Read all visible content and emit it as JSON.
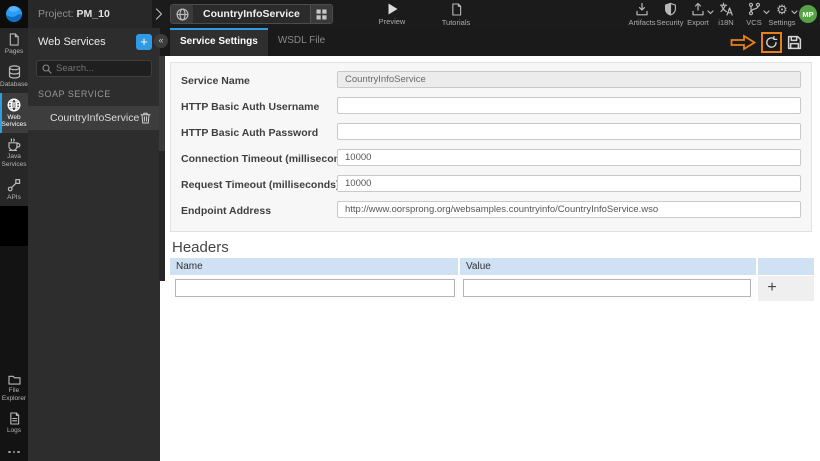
{
  "topbar": {
    "project_prefix": "Project:",
    "project_name": "PM_10",
    "breadcrumb": {
      "service_name": "CountryInfoService"
    },
    "preview_label": "Preview",
    "tutorials_label": "Tutorials",
    "menu": [
      {
        "label": "Artifacts",
        "icon": "download-tray-icon"
      },
      {
        "label": "Security",
        "icon": "shield-icon"
      },
      {
        "label": "Export",
        "icon": "upload-icon",
        "has_chevron": true
      },
      {
        "label": "i18N",
        "icon": "translate-icon"
      },
      {
        "label": "VCS",
        "icon": "branch-icon",
        "has_chevron": true
      },
      {
        "label": "Settings",
        "icon": "gear-icon",
        "has_chevron": true
      }
    ],
    "avatar_initials": "MP"
  },
  "sidebar": {
    "top_items": [
      {
        "label": "Pages",
        "icon": "page-icon",
        "active": false
      },
      {
        "label": "Databases",
        "icon": "database-icon",
        "active": false
      },
      {
        "label": "Web Services",
        "icon": "globe-icon",
        "active": true
      },
      {
        "label": "Java Services",
        "icon": "coffee-icon",
        "active": false
      },
      {
        "label": "APIs",
        "icon": "api-icon",
        "active": false
      }
    ],
    "bottom_items": [
      {
        "label": "File Explorer",
        "icon": "folder-icon"
      },
      {
        "label": "Logs",
        "icon": "log-file-icon"
      }
    ]
  },
  "panel": {
    "title": "Web Services",
    "add_label": "+",
    "collapse_glyph": "«",
    "search_placeholder": "Search...",
    "section_label": "SOAP SERVICE",
    "services": [
      {
        "name": "CountryInfoService",
        "selected": true
      }
    ]
  },
  "main": {
    "tabs": [
      {
        "label": "Service Settings",
        "active": true
      },
      {
        "label": "WSDL File",
        "active": false
      }
    ],
    "form": {
      "fields": [
        {
          "label": "Service Name",
          "value": "CountryInfoService",
          "disabled": true
        },
        {
          "label": "HTTP Basic Auth Username",
          "value": ""
        },
        {
          "label": "HTTP Basic Auth Password",
          "value": ""
        },
        {
          "label": "Connection Timeout (milliseconds)",
          "value": "10000"
        },
        {
          "label": "Request Timeout (milliseconds)",
          "value": "10000"
        },
        {
          "label": "Endpoint Address",
          "value": "http://www.oorsprong.org/websamples.countryinfo/CountryInfoService.wso"
        }
      ]
    },
    "headers": {
      "title": "Headers",
      "columns": [
        "Name",
        "Value"
      ],
      "rows": [
        {
          "name": "",
          "value": ""
        }
      ],
      "add_label": "+"
    }
  },
  "annotation": {
    "arrow_color": "#ea7f1a",
    "highlighted_control": "reload-button"
  },
  "colors": {
    "accent_blue": "#2e9be4",
    "avatar_green": "#55a346",
    "table_header_blue": "#cfe1f3"
  }
}
